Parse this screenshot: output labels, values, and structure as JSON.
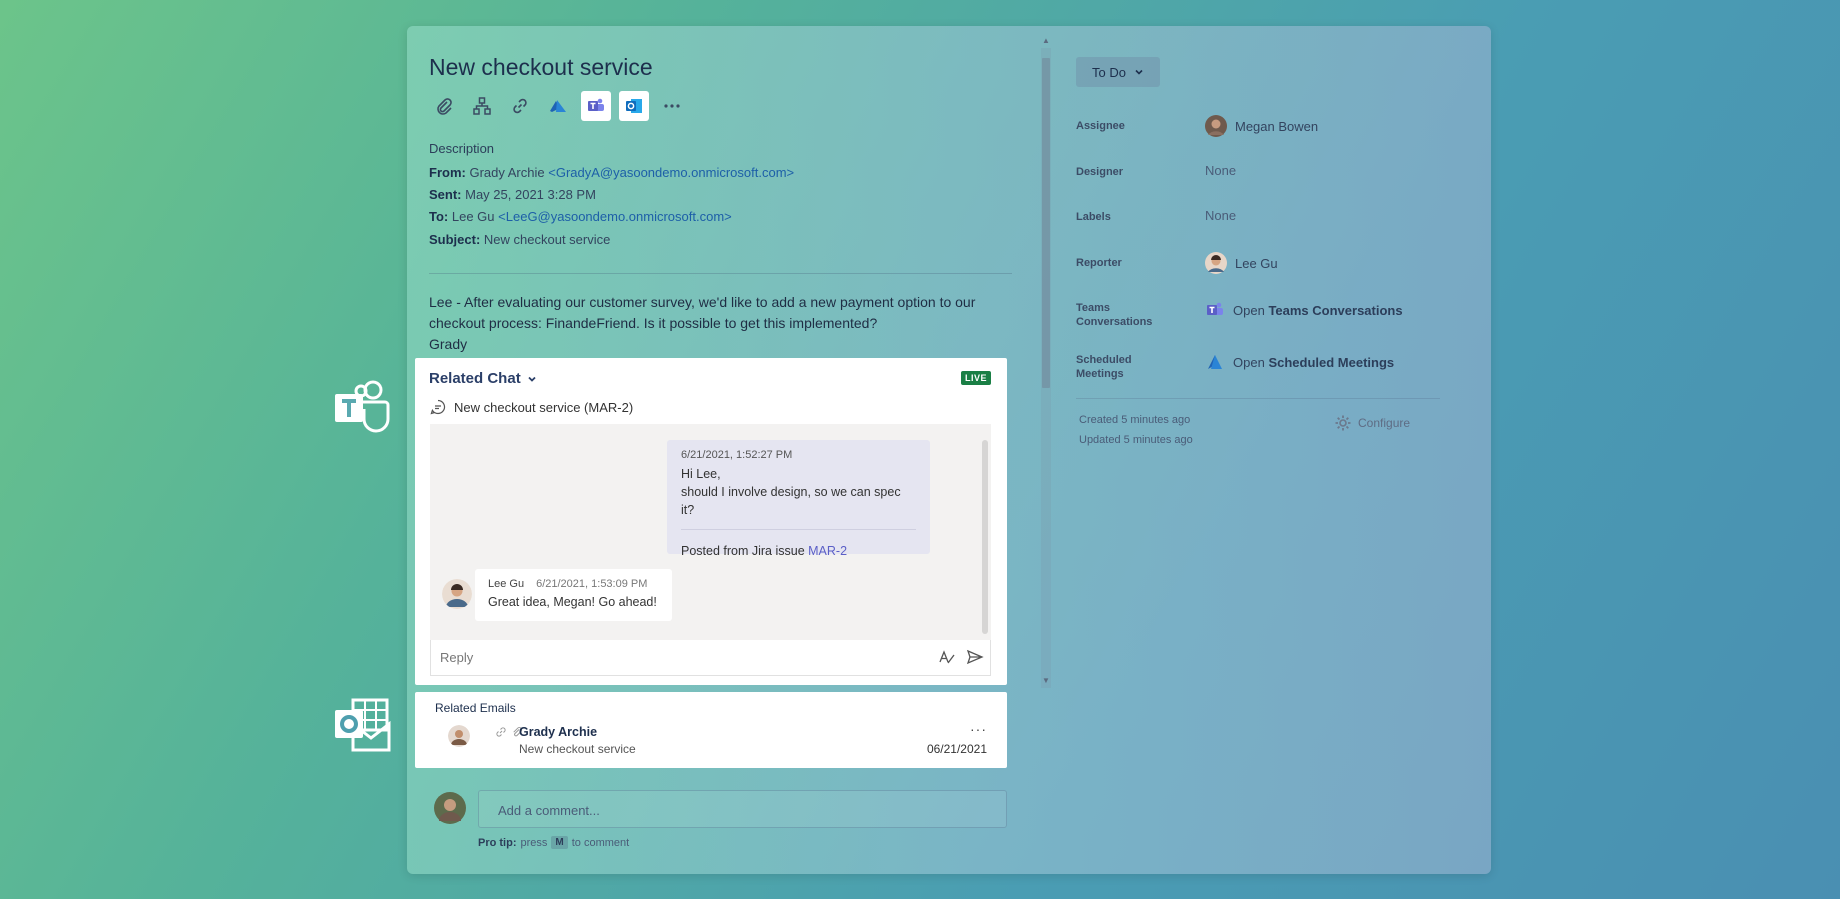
{
  "issue": {
    "title": "New checkout service",
    "description_heading": "Description",
    "from_label": "From:",
    "from_name": "Grady Archie",
    "from_email": "<GradyA@yasoondemo.onmicrosoft.com>",
    "sent_label": "Sent:",
    "sent_value": "May 25, 2021 3:28 PM",
    "to_label": "To:",
    "to_name": "Lee Gu",
    "to_email": "<LeeG@yasoondemo.onmicrosoft.com>",
    "subject_label": "Subject:",
    "subject_value": "New checkout service",
    "body": "Lee - After evaluating our customer survey, we'd like to add a new payment option to our checkout process: FinandeFriend. Is it possible to get this implemented?",
    "signature": "Grady"
  },
  "toolbar": {
    "icons": [
      "attachment-icon",
      "hierarchy-icon",
      "link-icon",
      "azure-devops-icon",
      "teams-icon",
      "outlook-icon",
      "more-icon"
    ]
  },
  "related_chat": {
    "heading": "Related Chat",
    "live_badge": "LIVE",
    "topic": "New checkout service (MAR-2)",
    "message_mine": {
      "time": "6/21/2021, 1:52:27 PM",
      "line1": "Hi Lee,",
      "line2": "should I involve design, so we can spec it?",
      "posted_prefix": "Posted from Jira issue ",
      "posted_link": "MAR-2"
    },
    "message_other": {
      "author": "Lee Gu",
      "time": "6/21/2021, 1:53:09 PM",
      "text": "Great idea, Megan! Go ahead!"
    },
    "reply_placeholder": "Reply"
  },
  "related_emails": {
    "heading": "Related Emails",
    "items": [
      {
        "from": "Grady Archie",
        "subject": "New checkout service",
        "date": "06/21/2021",
        "more": "···"
      }
    ]
  },
  "comment": {
    "placeholder": "Add a comment...",
    "protip_prefix": "Pro tip:",
    "protip_press": "press",
    "protip_key": "M",
    "protip_suffix": "to comment"
  },
  "sidebar": {
    "status": "To Do",
    "assignee_label": "Assignee",
    "assignee_value": "Megan Bowen",
    "designer_label": "Designer",
    "designer_value": "None",
    "labels_label": "Labels",
    "labels_value": "None",
    "reporter_label": "Reporter",
    "reporter_value": "Lee Gu",
    "teams_label_1": "Teams",
    "teams_label_2": "Conversations",
    "teams_open": "Open",
    "teams_value": "Teams Conversations",
    "meetings_label_1": "Scheduled",
    "meetings_label_2": "Meetings",
    "meetings_open": "Open",
    "meetings_value": "Scheduled Meetings",
    "created": "Created 5 minutes ago",
    "updated": "Updated 5 minutes ago",
    "configure": "Configure"
  },
  "colors": {
    "teams_purple": "#5b5fc7",
    "outlook_blue": "#0f6cbd",
    "live_green": "#1a7f45",
    "link_blue": "#1d5fa8"
  }
}
